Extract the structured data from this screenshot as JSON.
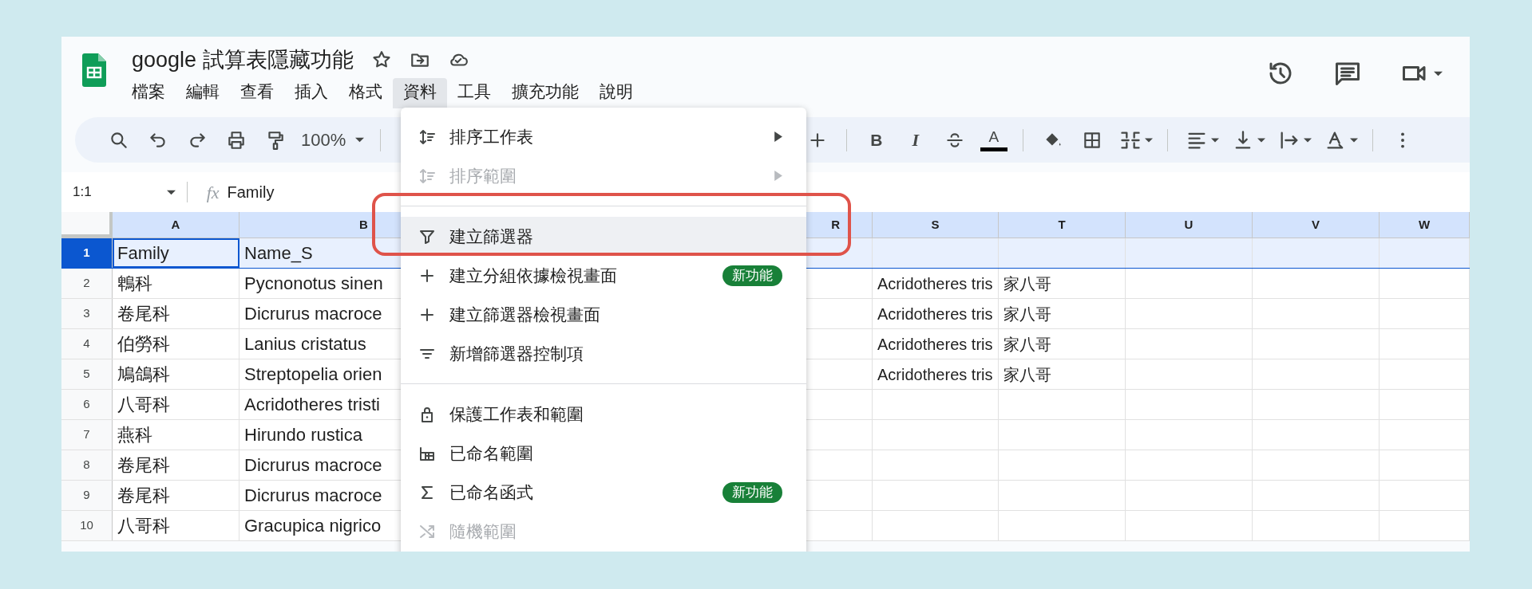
{
  "document": {
    "title": "google 試算表隱藏功能"
  },
  "menu_bar": [
    {
      "label": "檔案",
      "selected": false
    },
    {
      "label": "編輯",
      "selected": false
    },
    {
      "label": "查看",
      "selected": false
    },
    {
      "label": "插入",
      "selected": false
    },
    {
      "label": "格式",
      "selected": false
    },
    {
      "label": "資料",
      "selected": true
    },
    {
      "label": "工具",
      "selected": false
    },
    {
      "label": "擴充功能",
      "selected": false
    },
    {
      "label": "說明",
      "selected": false
    }
  ],
  "toolbar": {
    "left": [
      {
        "kind": "search"
      },
      {
        "kind": "undo"
      },
      {
        "kind": "redo"
      },
      {
        "kind": "print"
      },
      {
        "kind": "paint_format"
      },
      {
        "kind": "zoom",
        "label": "100%"
      },
      {
        "kind": "divider"
      }
    ],
    "right": [
      {
        "kind": "plus"
      },
      {
        "kind": "divider"
      },
      {
        "kind": "bold",
        "label": "B"
      },
      {
        "kind": "italic",
        "label": "I"
      },
      {
        "kind": "strikethrough"
      },
      {
        "kind": "text_color",
        "label": "A"
      },
      {
        "kind": "divider"
      },
      {
        "kind": "fill_color"
      },
      {
        "kind": "borders"
      },
      {
        "kind": "merge"
      },
      {
        "kind": "divider"
      },
      {
        "kind": "align"
      },
      {
        "kind": "valign"
      },
      {
        "kind": "wrap"
      },
      {
        "kind": "rotate"
      },
      {
        "kind": "divider"
      },
      {
        "kind": "more"
      }
    ]
  },
  "formula_bar": {
    "name_box": "1:1",
    "fx_label": "fx",
    "value": "Family"
  },
  "columns": [
    "A",
    "B",
    "R",
    "S",
    "T",
    "U",
    "V",
    "W"
  ],
  "rows": [
    {
      "number": "1",
      "selected": true,
      "cells": [
        "Family",
        "Name_S",
        null,
        null,
        null,
        null,
        null,
        null
      ]
    },
    {
      "number": "2",
      "selected": false,
      "cells": [
        "鵯科",
        "Pycnonotus sinen",
        null,
        "Acridotheres tris",
        "家八哥",
        null,
        null,
        null
      ]
    },
    {
      "number": "3",
      "selected": false,
      "cells": [
        "卷尾科",
        "Dicrurus macroce",
        null,
        "Acridotheres tris",
        "家八哥",
        null,
        null,
        null
      ]
    },
    {
      "number": "4",
      "selected": false,
      "cells": [
        "伯勞科",
        "Lanius cristatus",
        null,
        "Acridotheres tris",
        "家八哥",
        null,
        null,
        null
      ]
    },
    {
      "number": "5",
      "selected": false,
      "cells": [
        "鳩鴿科",
        "Streptopelia orien",
        null,
        "Acridotheres tris",
        "家八哥",
        null,
        null,
        null
      ]
    },
    {
      "number": "6",
      "selected": false,
      "cells": [
        "八哥科",
        "Acridotheres tristi",
        null,
        null,
        null,
        null,
        null,
        null
      ]
    },
    {
      "number": "7",
      "selected": false,
      "cells": [
        "燕科",
        "Hirundo rustica",
        null,
        null,
        null,
        null,
        null,
        null
      ]
    },
    {
      "number": "8",
      "selected": false,
      "cells": [
        "卷尾科",
        "Dicrurus macroce",
        null,
        null,
        null,
        null,
        null,
        null
      ]
    },
    {
      "number": "9",
      "selected": false,
      "cells": [
        "卷尾科",
        "Dicrurus macroce",
        null,
        null,
        null,
        null,
        null,
        null
      ]
    },
    {
      "number": "10",
      "selected": false,
      "cells": [
        "八哥科",
        "Gracupica nigrico",
        null,
        null,
        null,
        null,
        null,
        null
      ]
    }
  ],
  "data_menu": {
    "items": [
      {
        "kind": "sort",
        "label": "排序工作表",
        "disabled": false,
        "highlighted": false,
        "submenu": true
      },
      {
        "kind": "sort",
        "label": "排序範圍",
        "disabled": true,
        "highlighted": false,
        "submenu": true
      },
      {
        "kind": "divider"
      },
      {
        "kind": "filter",
        "label": "建立篩選器",
        "disabled": false,
        "highlighted": true,
        "submenu": false
      },
      {
        "kind": "plus",
        "label": "建立分組依據檢視畫面",
        "disabled": false,
        "highlighted": false,
        "submenu": false,
        "badge": "新功能"
      },
      {
        "kind": "plus",
        "label": "建立篩選器檢視畫面",
        "disabled": false,
        "highlighted": false,
        "submenu": false
      },
      {
        "kind": "filter_lines",
        "label": "新增篩選器控制項",
        "disabled": false,
        "highlighted": false,
        "submenu": false
      },
      {
        "kind": "divider"
      },
      {
        "kind": "lock",
        "label": "保護工作表和範圍",
        "disabled": false,
        "highlighted": false,
        "submenu": false
      },
      {
        "kind": "named_range",
        "label": "已命名範圍",
        "disabled": false,
        "highlighted": false,
        "submenu": false
      },
      {
        "kind": "sigma",
        "label": "已命名函式",
        "disabled": false,
        "highlighted": false,
        "submenu": false,
        "badge": "新功能"
      },
      {
        "kind": "shuffle",
        "label": "隨機範圍",
        "disabled": true,
        "highlighted": false,
        "submenu": false
      }
    ]
  }
}
